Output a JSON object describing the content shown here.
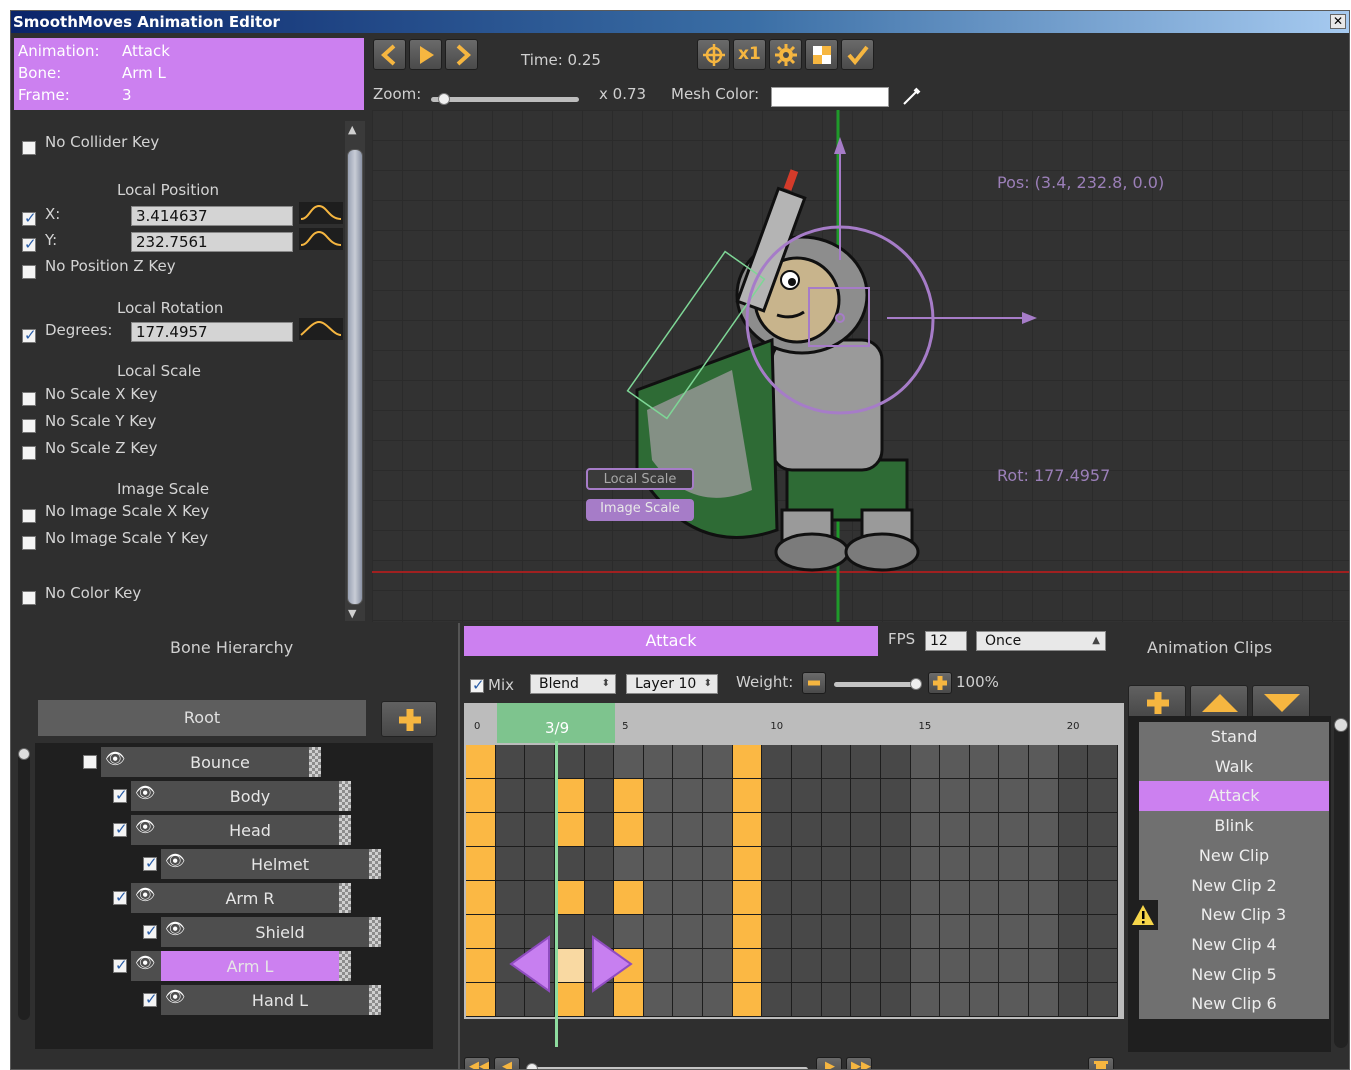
{
  "window": {
    "title": "SmoothMoves Animation Editor",
    "close_glyph": "✕"
  },
  "info": {
    "animation_label": "Animation:",
    "animation_value": "Attack",
    "bone_label": "Bone:",
    "bone_value": "Arm L",
    "frame_label": "Frame:",
    "frame_value": "3"
  },
  "toolbar": {
    "time_label": "Time: 0.25",
    "zoom_label": "Zoom:",
    "zoom_value": "x 0.73",
    "zoom_fraction": 0.05,
    "mesh_color_label": "Mesh Color:",
    "mesh_color": "#ffffff",
    "speed_label": "x1",
    "icons": [
      "prev-frame-icon",
      "play-icon",
      "next-frame-icon",
      "crosshair-icon",
      "speed-icon",
      "gear-icon",
      "checker-icon",
      "checkmark-icon",
      "eyedropper-icon"
    ]
  },
  "inspector": {
    "no_collider_key": "No Collider Key",
    "local_position": "Local Position",
    "x_label": "X:",
    "x_value": "3.414637",
    "y_label": "Y:",
    "y_value": "232.7561",
    "no_position_z_key": "No Position Z Key",
    "local_rotation": "Local Rotation",
    "degrees_label": "Degrees:",
    "degrees_value": "177.4957",
    "local_scale": "Local Scale",
    "no_scale_x_key": "No Scale X Key",
    "no_scale_y_key": "No Scale Y Key",
    "no_scale_z_key": "No Scale Z Key",
    "image_scale": "Image Scale",
    "no_image_scale_x_key": "No Image Scale X Key",
    "no_image_scale_y_key": "No Image Scale Y Key",
    "no_color_key": "No Color Key",
    "checked": {
      "collider": false,
      "x": true,
      "y": true,
      "pos_z": false,
      "degrees": true,
      "scale_x": false,
      "scale_y": false,
      "scale_z": false,
      "img_x": false,
      "img_y": false,
      "color": false
    }
  },
  "viewport": {
    "pos_text": "Pos: (3.4, 232.8, 0.0)",
    "rot_text": "Rot: 177.4957",
    "local_scale_btn": "Local Scale",
    "image_scale_btn": "Image Scale"
  },
  "bones": {
    "title": "Bone Hierarchy",
    "root": "Root",
    "items": [
      {
        "name": "Bounce",
        "depth": 0,
        "checked": false,
        "selected": false
      },
      {
        "name": "Body",
        "depth": 1,
        "checked": true,
        "selected": false
      },
      {
        "name": "Head",
        "depth": 1,
        "checked": true,
        "selected": false
      },
      {
        "name": "Helmet",
        "depth": 2,
        "checked": true,
        "selected": false
      },
      {
        "name": "Arm R",
        "depth": 1,
        "checked": true,
        "selected": false
      },
      {
        "name": "Shield",
        "depth": 2,
        "checked": true,
        "selected": false
      },
      {
        "name": "Arm L",
        "depth": 1,
        "checked": true,
        "selected": true
      },
      {
        "name": "Hand L",
        "depth": 2,
        "checked": true,
        "selected": false
      }
    ]
  },
  "timeline": {
    "clip_name": "Attack",
    "fps_label": "FPS",
    "fps_value": "12",
    "wrap_mode": "Once",
    "mix_label": "Mix",
    "blend": "Blend",
    "layer": "Layer 10",
    "weight_label": "Weight:",
    "weight_value": "100%",
    "weight_fraction": 1.0,
    "frame_range": "3/9",
    "ticks": [
      "0",
      "5",
      "10",
      "15",
      "20"
    ],
    "frames_total": 22,
    "rows": 8,
    "current_frame": 3,
    "key_colors": {
      "key": "#fbb844",
      "current": "#f9d9a2"
    },
    "keyframes": [
      [
        0,
        9
      ],
      [
        0,
        3,
        5,
        9
      ],
      [
        0,
        3,
        5,
        9
      ],
      [
        0,
        9
      ],
      [
        0,
        3,
        5,
        9
      ],
      [
        0,
        9
      ],
      [
        0,
        3,
        5,
        9
      ],
      [
        0,
        3,
        5,
        9
      ]
    ]
  },
  "clips": {
    "title": "Animation Clips",
    "items": [
      "Stand",
      "Walk",
      "Attack",
      "Blink",
      "New Clip",
      "New Clip 2",
      "New Clip 3",
      "New Clip 4",
      "New Clip 5",
      "New Clip 6"
    ],
    "selected": "Attack",
    "warning_on": "New Clip 3"
  }
}
